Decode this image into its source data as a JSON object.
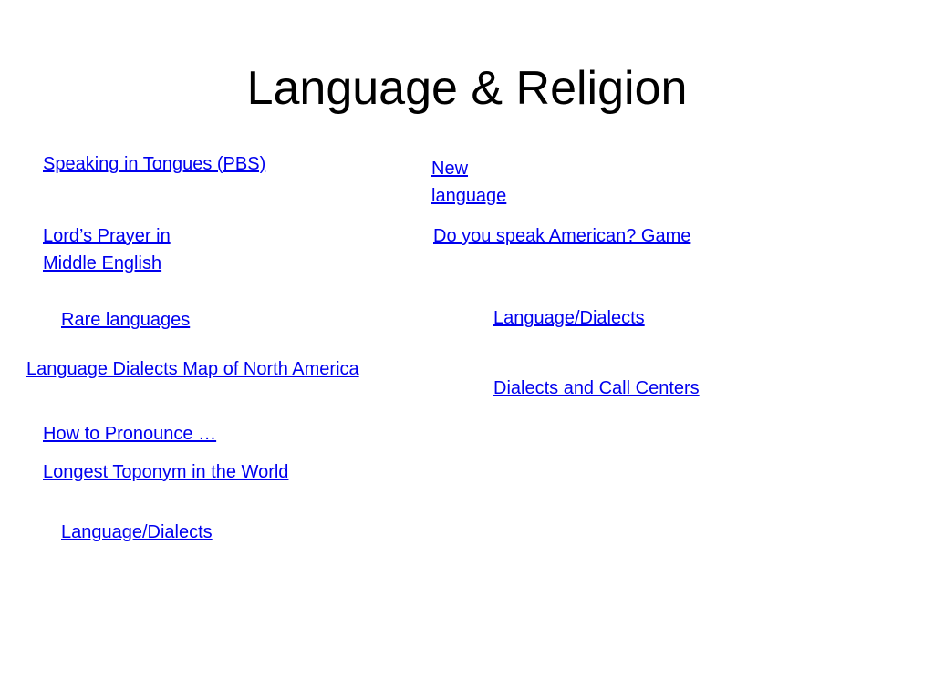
{
  "slide": {
    "title": "Language & Religion",
    "link_color": "#0000ee"
  },
  "left_links": [
    {
      "label": "Speaking in Tongues (PBS)"
    },
    {
      "label": "Lord’s Prayer in Middle English"
    },
    {
      "label": "Rare languages"
    },
    {
      "label": "Language Dialects Map of North America"
    },
    {
      "label": "How to Pronounce …"
    },
    {
      "label": "Longest Toponym in the World"
    },
    {
      "label": "Language/Dialects"
    }
  ],
  "right_links": [
    {
      "label": "New language"
    },
    {
      "label": "Do you speak American? Game"
    },
    {
      "label": "Language/Dialects"
    },
    {
      "label": "Dialects and Call Centers"
    }
  ]
}
